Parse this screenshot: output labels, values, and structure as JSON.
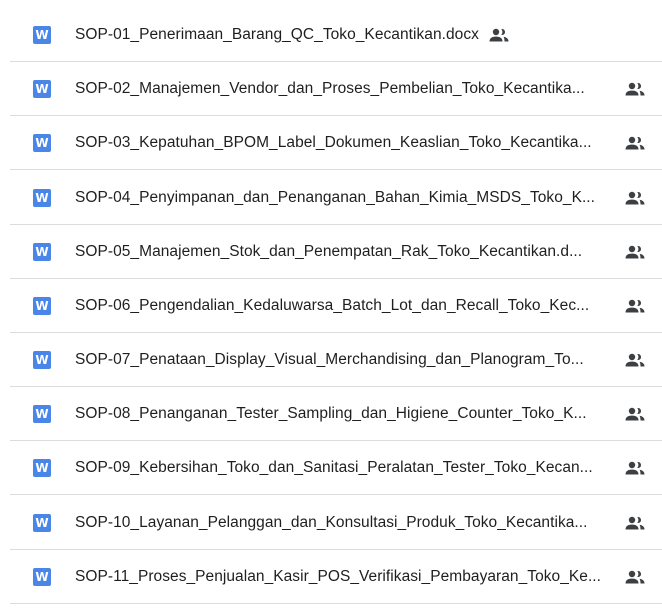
{
  "icons": {
    "file_type": "word-doc-icon",
    "file_type_letter": "W",
    "shared": "shared-people-icon"
  },
  "colors": {
    "word_blue": "#4a86e8",
    "text": "#1f1f1f",
    "divider": "#dadce0",
    "shared_icon": "#3c4043"
  },
  "files": [
    {
      "name": "SOP-01_Penerimaan_Barang_QC_Toko_Kecantikan.docx"
    },
    {
      "name": "SOP-02_Manajemen_Vendor_dan_Proses_Pembelian_Toko_Kecantika..."
    },
    {
      "name": "SOP-03_Kepatuhan_BPOM_Label_Dokumen_Keaslian_Toko_Kecantika..."
    },
    {
      "name": "SOP-04_Penyimpanan_dan_Penanganan_Bahan_Kimia_MSDS_Toko_K..."
    },
    {
      "name": "SOP-05_Manajemen_Stok_dan_Penempatan_Rak_Toko_Kecantikan.d..."
    },
    {
      "name": "SOP-06_Pengendalian_Kedaluwarsa_Batch_Lot_dan_Recall_Toko_Kec..."
    },
    {
      "name": "SOP-07_Penataan_Display_Visual_Merchandising_dan_Planogram_To..."
    },
    {
      "name": "SOP-08_Penanganan_Tester_Sampling_dan_Higiene_Counter_Toko_K..."
    },
    {
      "name": "SOP-09_Kebersihan_Toko_dan_Sanitasi_Peralatan_Tester_Toko_Kecan..."
    },
    {
      "name": "SOP-10_Layanan_Pelanggan_dan_Konsultasi_Produk_Toko_Kecantika..."
    },
    {
      "name": "SOP-11_Proses_Penjualan_Kasir_POS_Verifikasi_Pembayaran_Toko_Ke..."
    }
  ]
}
